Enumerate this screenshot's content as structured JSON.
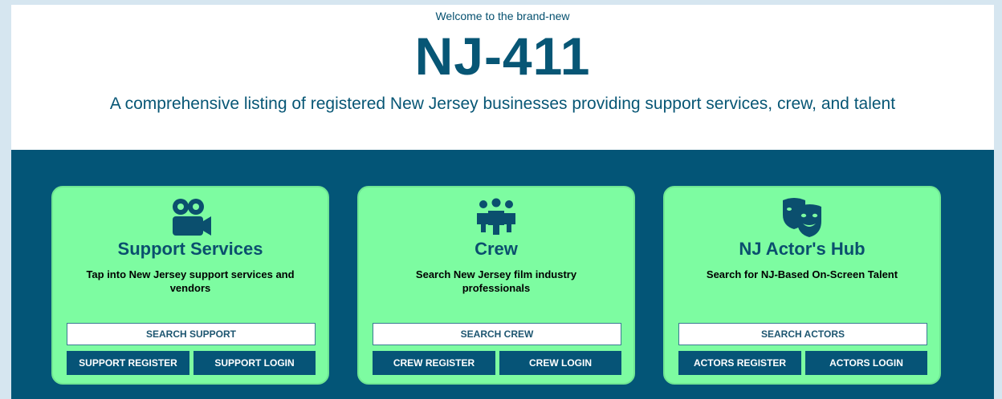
{
  "hero": {
    "welcome": "Welcome to the brand-new",
    "brand": "NJ-411",
    "tagline": "A comprehensive listing of registered New Jersey businesses providing support services, crew, and talent"
  },
  "colors": {
    "page_bg": "#d6e6f0",
    "hero_bg": "#ffffff",
    "band_bg": "#035577",
    "card_bg": "#7dfca1",
    "button_bg": "#065477",
    "brand_text": "#075675"
  },
  "cards": [
    {
      "icon": "video-camera-icon",
      "title": "Support Services",
      "description": "Tap into New Jersey support services and vendors",
      "search_label": "SEARCH SUPPORT",
      "register_label": "SUPPORT REGISTER",
      "login_label": "SUPPORT LOGIN"
    },
    {
      "icon": "people-group-icon",
      "title": "Crew",
      "description": "Search New Jersey film industry professionals",
      "search_label": "SEARCH CREW",
      "register_label": "CREW REGISTER",
      "login_label": "CREW LOGIN"
    },
    {
      "icon": "theater-masks-icon",
      "title": "NJ Actor's Hub",
      "description": "Search for NJ-Based On-Screen Talent",
      "search_label": "SEARCH ACTORS",
      "register_label": "ACTORS REGISTER",
      "login_label": "ACTORS LOGIN"
    }
  ]
}
